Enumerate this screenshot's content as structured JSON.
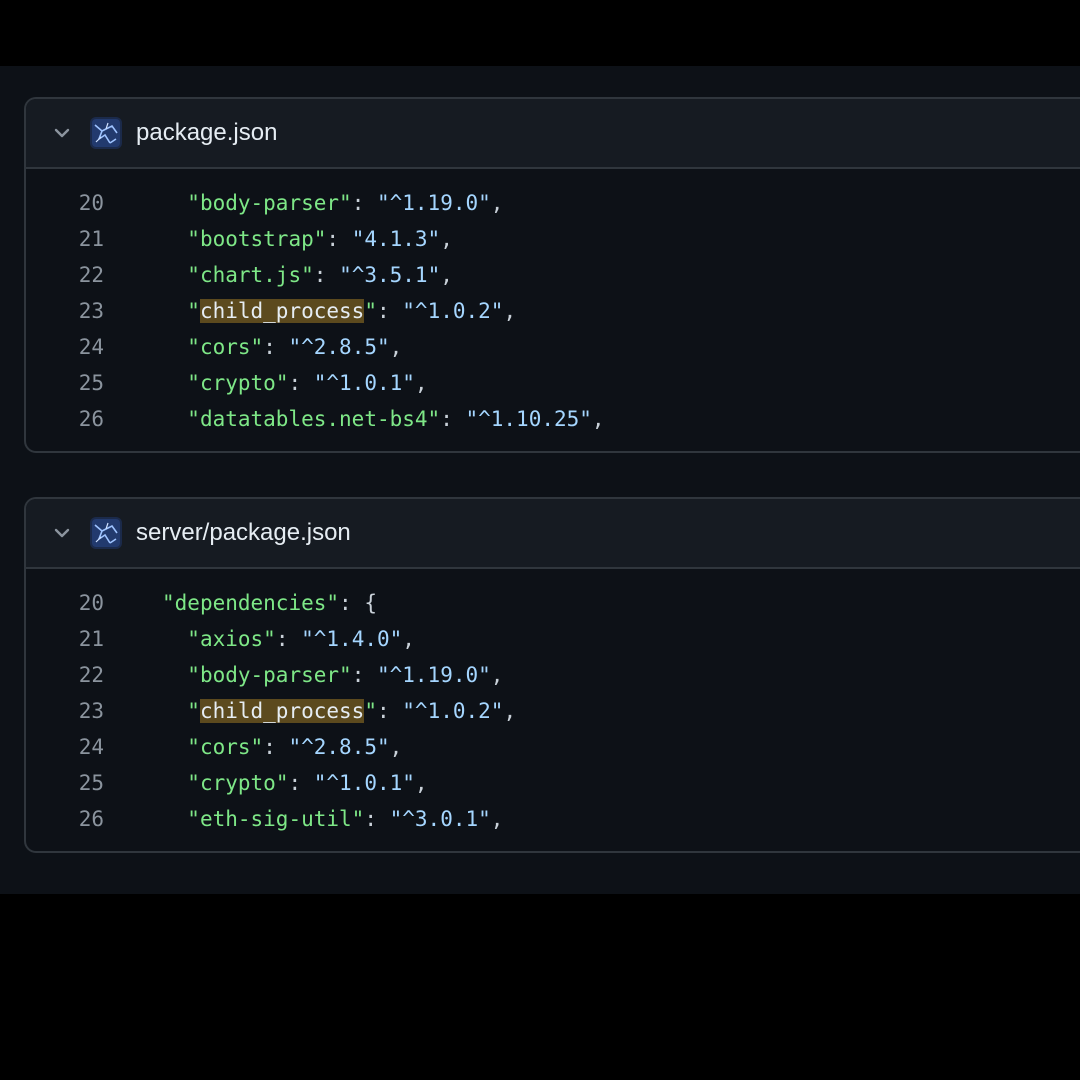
{
  "results": [
    {
      "file_name": "package.json",
      "lines": [
        {
          "num": "20",
          "indent": "  ",
          "pre": "\"",
          "hl": "",
          "key": "body-parser",
          "post": "\"",
          "sep": ": ",
          "value": "\"^1.19.0\"",
          "end": ","
        },
        {
          "num": "21",
          "indent": "  ",
          "pre": "\"",
          "hl": "",
          "key": "bootstrap",
          "post": "\"",
          "sep": ": ",
          "value": "\"4.1.3\"",
          "end": ","
        },
        {
          "num": "22",
          "indent": "  ",
          "pre": "\"",
          "hl": "",
          "key": "chart.js",
          "post": "\"",
          "sep": ": ",
          "value": "\"^3.5.1\"",
          "end": ","
        },
        {
          "num": "23",
          "indent": "  ",
          "pre": "\"",
          "hl": "child_process",
          "key": "",
          "post": "\"",
          "sep": ": ",
          "value": "\"^1.0.2\"",
          "end": ","
        },
        {
          "num": "24",
          "indent": "  ",
          "pre": "\"",
          "hl": "",
          "key": "cors",
          "post": "\"",
          "sep": ": ",
          "value": "\"^2.8.5\"",
          "end": ","
        },
        {
          "num": "25",
          "indent": "  ",
          "pre": "\"",
          "hl": "",
          "key": "crypto",
          "post": "\"",
          "sep": ": ",
          "value": "\"^1.0.1\"",
          "end": ","
        },
        {
          "num": "26",
          "indent": "  ",
          "pre": "\"",
          "hl": "",
          "key": "datatables.net-bs4",
          "post": "\"",
          "sep": ": ",
          "value": "\"^1.10.25\"",
          "end": ","
        }
      ]
    },
    {
      "file_name": "server/package.json",
      "lines": [
        {
          "num": "20",
          "indent": "",
          "pre": "\"",
          "hl": "",
          "key": "dependencies",
          "post": "\"",
          "sep": ": ",
          "value": "",
          "end": "{"
        },
        {
          "num": "21",
          "indent": "  ",
          "pre": "\"",
          "hl": "",
          "key": "axios",
          "post": "\"",
          "sep": ": ",
          "value": "\"^1.4.0\"",
          "end": ","
        },
        {
          "num": "22",
          "indent": "  ",
          "pre": "\"",
          "hl": "",
          "key": "body-parser",
          "post": "\"",
          "sep": ": ",
          "value": "\"^1.19.0\"",
          "end": ","
        },
        {
          "num": "23",
          "indent": "  ",
          "pre": "\"",
          "hl": "child_process",
          "key": "",
          "post": "\"",
          "sep": ": ",
          "value": "\"^1.0.2\"",
          "end": ","
        },
        {
          "num": "24",
          "indent": "  ",
          "pre": "\"",
          "hl": "",
          "key": "cors",
          "post": "\"",
          "sep": ": ",
          "value": "\"^2.8.5\"",
          "end": ","
        },
        {
          "num": "25",
          "indent": "  ",
          "pre": "\"",
          "hl": "",
          "key": "crypto",
          "post": "\"",
          "sep": ": ",
          "value": "\"^1.0.1\"",
          "end": ","
        },
        {
          "num": "26",
          "indent": "  ",
          "pre": "\"",
          "hl": "",
          "key": "eth-sig-util",
          "post": "\"",
          "sep": ": ",
          "value": "\"^3.0.1\"",
          "end": ","
        }
      ]
    }
  ],
  "icons": {
    "collapse": "chevron-down-icon",
    "avatar": "repository-avatar"
  },
  "colors": {
    "background": "#0d1117",
    "header": "#161b22",
    "border": "#30363d",
    "key": "#7ee787",
    "string": "#a5d6ff",
    "match_highlight": "#5c4a1e",
    "line_number": "#8b949e"
  }
}
